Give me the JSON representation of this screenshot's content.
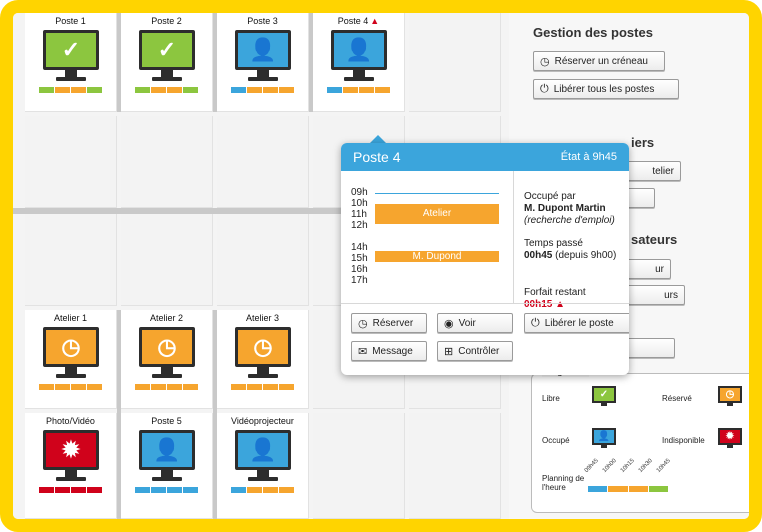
{
  "stations": [
    {
      "label": "Poste 1",
      "state": "libre",
      "color": "#8cc63f",
      "glyph": "✓",
      "icon": "check-icon",
      "bar": [
        "#8cc63f",
        "#f6a52e",
        "#f6a52e",
        "#8cc63f"
      ]
    },
    {
      "label": "Poste 2",
      "state": "libre",
      "color": "#8cc63f",
      "glyph": "✓",
      "icon": "check-icon",
      "bar": [
        "#8cc63f",
        "#f6a52e",
        "#f6a52e",
        "#8cc63f"
      ]
    },
    {
      "label": "Poste 3",
      "state": "occupe",
      "color": "#3ba5dc",
      "glyph": "👤",
      "icon": "user-icon",
      "bar": [
        "#3ba5dc",
        "#f6a52e",
        "#f6a52e",
        "#f6a52e"
      ]
    },
    {
      "label": "Poste 4",
      "state": "occupe",
      "color": "#3ba5dc",
      "glyph": "👤",
      "icon": "user-icon",
      "warning": "▲",
      "bar": [
        "#3ba5dc",
        "#f6a52e",
        "#f6a52e",
        "#f6a52e"
      ]
    },
    {
      "label": "Atelier 1",
      "state": "reserve",
      "color": "#f6a52e",
      "glyph": "◷",
      "icon": "clock-icon",
      "bar": [
        "#f6a52e",
        "#f6a52e",
        "#f6a52e",
        "#f6a52e"
      ]
    },
    {
      "label": "Atelier 2",
      "state": "reserve",
      "color": "#f6a52e",
      "glyph": "◷",
      "icon": "clock-icon",
      "bar": [
        "#f6a52e",
        "#f6a52e",
        "#f6a52e",
        "#f6a52e"
      ]
    },
    {
      "label": "Atelier 3",
      "state": "reserve",
      "color": "#f6a52e",
      "glyph": "◷",
      "icon": "clock-icon",
      "bar": [
        "#f6a52e",
        "#f6a52e",
        "#f6a52e",
        "#f6a52e"
      ]
    },
    {
      "label": "Photo/Vidéo",
      "state": "indisponible",
      "color": "#d0021b",
      "glyph": "✹",
      "icon": "gear-icon",
      "bar": [
        "#d0021b",
        "#d0021b",
        "#d0021b",
        "#d0021b"
      ]
    },
    {
      "label": "Poste 5",
      "state": "occupe",
      "color": "#3ba5dc",
      "glyph": "👤",
      "icon": "user-icon",
      "bar": [
        "#3ba5dc",
        "#3ba5dc",
        "#3ba5dc",
        "#3ba5dc"
      ]
    },
    {
      "label": "Vidéoprojecteur",
      "state": "occupe",
      "color": "#3ba5dc",
      "glyph": "👤",
      "icon": "user-icon",
      "bar": [
        "#3ba5dc",
        "#f6a52e",
        "#f6a52e",
        "#f6a52e"
      ]
    }
  ],
  "panel": {
    "title_postes": "Gestion des postes",
    "btn_reserver_creneau": "Réserver un créneau",
    "btn_liberer_tous": "Libérer tous les postes",
    "title_ateliers_partial": "iers",
    "btn_atelier_partial": "telier",
    "title_utilisateurs_partial": "sateurs",
    "btn_ur_partial": "ur",
    "btn_urs_partial": "urs"
  },
  "legend": {
    "title": "Légende",
    "libre": "Libre",
    "reserve": "Réservé",
    "occupe": "Occupé",
    "indisponible": "Indisponible",
    "planning": "Planning de l'heure",
    "times": [
      "09h45",
      "10h00",
      "10h15",
      "10h30",
      "10h45"
    ]
  },
  "popup": {
    "title": "Poste 4",
    "state": "État à 9h45",
    "hours": [
      "09h",
      "10h",
      "11h",
      "12h",
      "",
      "14h",
      "15h",
      "16h",
      "17h"
    ],
    "slot_atelier": "Atelier",
    "slot_dupond": "M. Dupond",
    "occupe_par_label": "Occupé par",
    "user_name": "M. Dupont Martin",
    "user_reason": "(recherche d'emploi)",
    "temps_passe_label": "Temps passé",
    "temps_passe_value": "00h45",
    "temps_passe_since": "(depuis 9h00)",
    "forfait_label": "Forfait restant",
    "forfait_value": "00h15",
    "btn_reserver": "Réserver",
    "btn_voir": "Voir",
    "btn_liberer": "Libérer le poste",
    "btn_message": "Message",
    "btn_controler": "Contrôler"
  }
}
